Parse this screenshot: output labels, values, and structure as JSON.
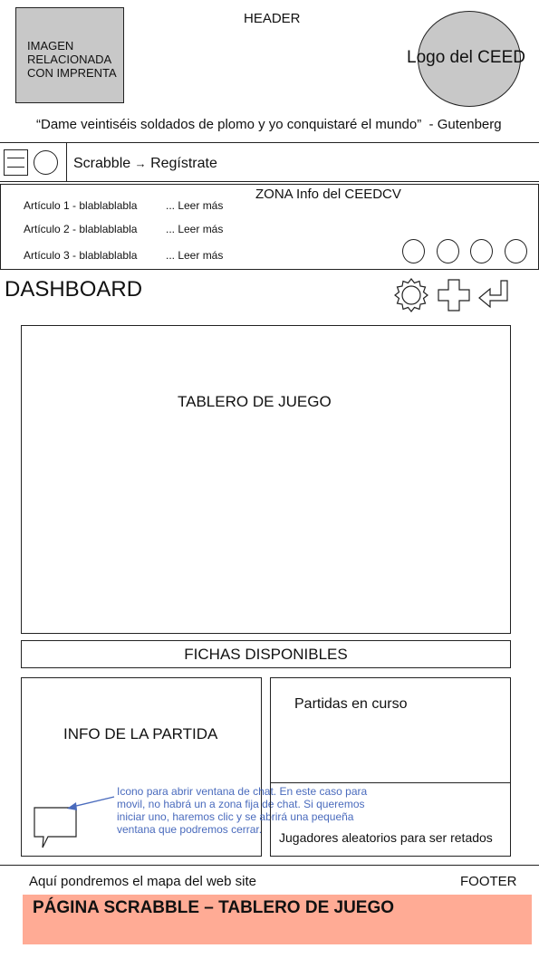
{
  "header": {
    "label": "HEADER",
    "image_placeholder": [
      "IMAGEN",
      "RELACIONADA",
      "CON IMPRENTA"
    ],
    "logo_text": "Logo del CEED",
    "quote": "“Dame veintiséis soldados de plomo y yo conquistaré el mundo”  - Gutenberg"
  },
  "navbar": {
    "breadcrumb_start": "Scrabble",
    "breadcrumb_arrow": "→",
    "breadcrumb_end": "Regístrate",
    "icons": [
      "menu-icon",
      "profile-circle-icon"
    ]
  },
  "info_zone": {
    "title": "ZONA Info del CEEDCV",
    "articles": [
      {
        "label": "Artículo 1 - blablablabla",
        "more": "... Leer más"
      },
      {
        "label": "Artículo 2 - blablablabla",
        "more": "... Leer más"
      },
      {
        "label": "Artículo 3 - blablablabla",
        "more": "... Leer más"
      }
    ],
    "circle_icons": [
      "social-icon-1",
      "social-icon-2",
      "social-icon-3",
      "social-icon-4"
    ]
  },
  "dashboard": {
    "title": "DASHBOARD",
    "actions": [
      "gear-icon",
      "plus-icon",
      "return-icon"
    ]
  },
  "main": {
    "board_label": "TABLERO DE JUEGO",
    "tiles_label": "FICHAS DISPONIBLES",
    "game_info_label": "INFO DE LA PARTIDA",
    "current_games_label": "Partidas en curso",
    "random_players_label": "Jugadores aleatorios para ser retados",
    "chat_note": "Icono para abrir ventana de chat. En este caso para movil, no habrá un a zona fija de chat. Si queremos iniciar uno, haremos clic y se abrirá una pequeña ventana que podremos cerrar."
  },
  "footer": {
    "sitemap_text": "Aquí pondremos el mapa del web site",
    "label": "FOOTER",
    "page_title": "PÁGINA SCRABBLE – TABLERO DE JUEGO"
  },
  "colors": {
    "placeholder_gray": "#c8c8c8",
    "note_blue": "#4a6bbd",
    "banner_salmon": "#ffab95"
  }
}
